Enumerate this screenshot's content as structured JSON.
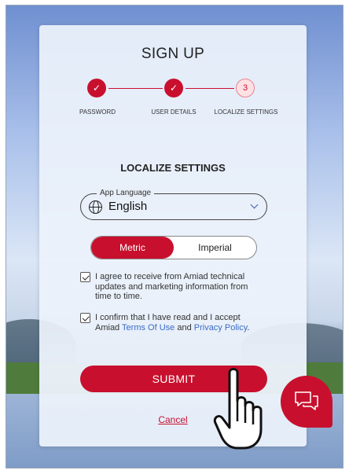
{
  "signup": {
    "title": "SIGN UP",
    "steps": [
      {
        "label": "PASSWORD",
        "state": "done"
      },
      {
        "label": "USER DETAILS",
        "state": "done"
      },
      {
        "label": "LOCALIZE SETTINGS",
        "state": "current",
        "number": "3"
      }
    ]
  },
  "localize": {
    "heading": "LOCALIZE SETTINGS",
    "language_label": "App Language",
    "language_value": "English",
    "units": {
      "metric": "Metric",
      "imperial": "Imperial",
      "selected": "Metric"
    }
  },
  "consents": {
    "marketing": "I agree to receive from Amiad technical updates and marketing information from time to time.",
    "terms_prefix": "I confirm that I have read and I accept Amiad ",
    "terms_link": "Terms Of Use",
    "terms_and": " and ",
    "privacy_link": "Privacy Policy",
    "terms_suffix": "."
  },
  "actions": {
    "submit": "SUBMIT",
    "cancel": "Cancel"
  },
  "colors": {
    "brand": "#c8102e",
    "link": "#3a6bc6"
  },
  "icons": {
    "step_done": "check-icon",
    "language": "globe-icon",
    "dropdown": "chevron-down-icon",
    "chat": "chat-bubbles-icon",
    "cursor": "hand-cursor-icon"
  }
}
